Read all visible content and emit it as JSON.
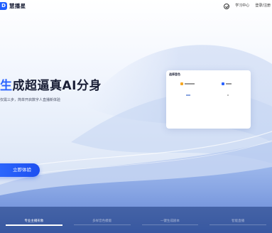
{
  "header": {
    "brand": "慧播星",
    "logo_letter": "D",
    "links": [
      "学习中心",
      "登录/注册"
    ]
  },
  "hero": {
    "title_accent": "生",
    "title_rest": "成超逼真AI分身",
    "subtitle": "仅需三步，简单开启数字人直播新体验",
    "cta_label": "立即体验"
  },
  "card": {
    "title": "选择音色",
    "items": [
      "",
      "",
      "",
      ""
    ]
  },
  "tabs": [
    {
      "label": "专业主播形象",
      "active": true
    },
    {
      "label": "多样音色模版",
      "active": false
    },
    {
      "label": "一键生成剧本",
      "active": false
    },
    {
      "label": "智能直播",
      "active": false
    }
  ],
  "colors": {
    "accent": "#2a63ff",
    "brand": "#1f5eff"
  }
}
